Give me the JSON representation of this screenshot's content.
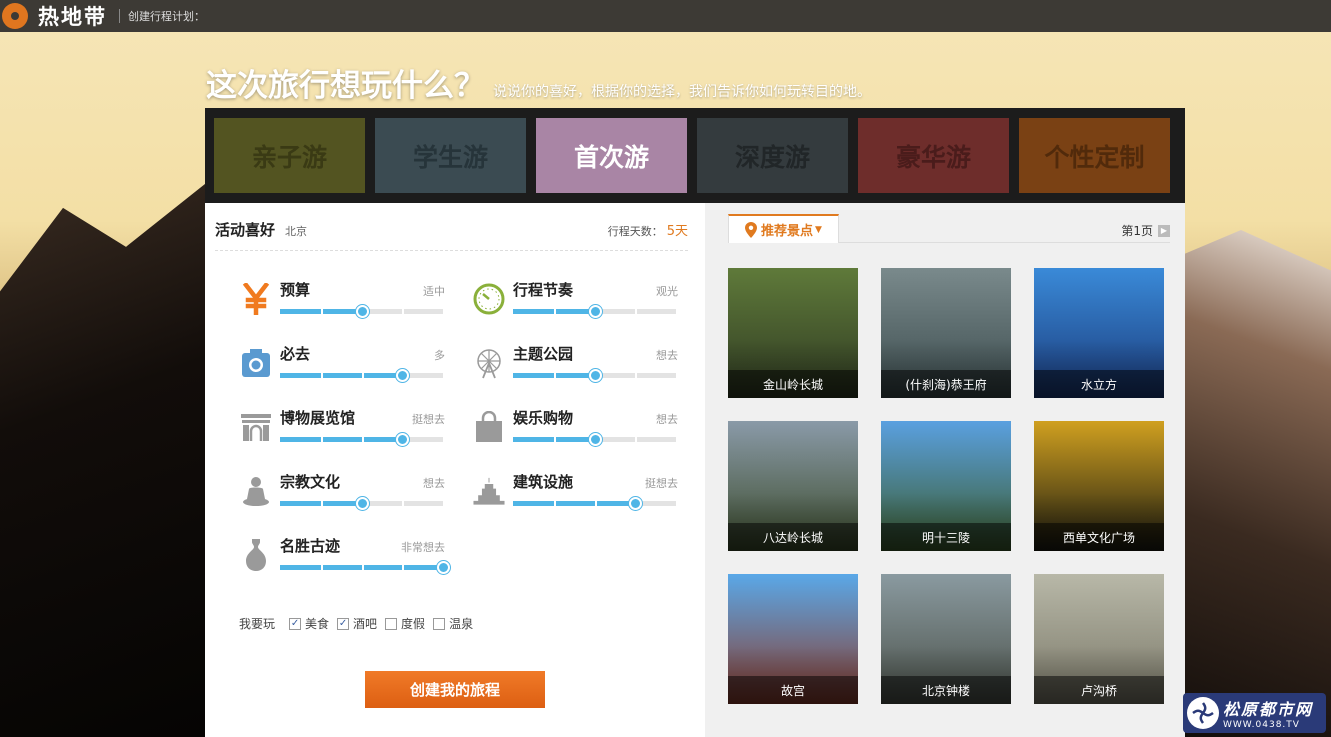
{
  "topbar": {
    "brand": "热地带",
    "crumb": "创建行程计划："
  },
  "headline": {
    "title": "这次旅行想玩什么？",
    "subtitle": "说说你的喜好，根据你的选择，我们告诉你如何玩转目的地。"
  },
  "tabs": [
    {
      "label": "亲子游",
      "bg": "#535421",
      "fg": "#3a3a14"
    },
    {
      "label": "学生游",
      "bg": "#3b4b52",
      "fg": "#26343a"
    },
    {
      "label": "首次游",
      "bg": "#a985a5",
      "fg": "#ffffff",
      "selected": true
    },
    {
      "label": "深度游",
      "bg": "#343b3e",
      "fg": "#212628"
    },
    {
      "label": "豪华游",
      "bg": "#6e2d2b",
      "fg": "#4a1c1b"
    },
    {
      "label": "个性定制",
      "bg": "#7a4114",
      "fg": "#512a0b"
    }
  ],
  "preferences": {
    "title": "活动喜好",
    "city": "北京",
    "days_label": "行程天数：",
    "days_value": "5天",
    "sliders": [
      {
        "name": "预算",
        "level": "适中",
        "icon": "yen-icon",
        "value": 0.5
      },
      {
        "name": "行程节奏",
        "level": "观光",
        "icon": "clock-icon",
        "value": 0.5
      },
      {
        "name": "必去",
        "level": "多",
        "icon": "camera-icon",
        "value": 0.75
      },
      {
        "name": "主题公园",
        "level": "想去",
        "icon": "ferris-wheel-icon",
        "value": 0.5
      },
      {
        "name": "博物展览馆",
        "level": "挺想去",
        "icon": "museum-icon",
        "value": 0.75
      },
      {
        "name": "娱乐购物",
        "level": "想去",
        "icon": "shopping-bag-icon",
        "value": 0.5
      },
      {
        "name": "宗教文化",
        "level": "想去",
        "icon": "buddha-icon",
        "value": 0.5
      },
      {
        "name": "建筑设施",
        "level": "挺想去",
        "icon": "building-icon",
        "value": 0.75
      },
      {
        "name": "名胜古迹",
        "level": "非常想去",
        "icon": "vase-icon",
        "value": 1.0
      }
    ],
    "want_label": "我要玩",
    "options": [
      {
        "label": "美食",
        "checked": true
      },
      {
        "label": "酒吧",
        "checked": true
      },
      {
        "label": "度假",
        "checked": false
      },
      {
        "label": "温泉",
        "checked": false
      }
    ],
    "create_button": "创建我的旅程"
  },
  "recommend": {
    "tab_label": "推荐景点",
    "page_label": "第1页",
    "spots": [
      {
        "name": "金山岭长城",
        "c1": "#5f7a3a",
        "c2": "#2f3a22"
      },
      {
        "name": "(什刹海)恭王府",
        "c1": "#7a8a8c",
        "c2": "#3a4a4c"
      },
      {
        "name": "水立方",
        "c1": "#3a8ad8",
        "c2": "#1a3a7a"
      },
      {
        "name": "八达岭长城",
        "c1": "#8a9aa8",
        "c2": "#3a4a2a"
      },
      {
        "name": "明十三陵",
        "c1": "#5aa0e0",
        "c2": "#3a5a2a"
      },
      {
        "name": "西单文化广场",
        "c1": "#d0a020",
        "c2": "#1a1a10"
      },
      {
        "name": "故宫",
        "c1": "#5aa8e8",
        "c2": "#8a3a2a"
      },
      {
        "name": "北京钟楼",
        "c1": "#8a9aa0",
        "c2": "#4a5048"
      },
      {
        "name": "卢沟桥",
        "c1": "#b8b8a8",
        "c2": "#7a7868"
      }
    ]
  },
  "watermark": {
    "name": "松原都市网",
    "url": "WWW.0438.TV"
  }
}
